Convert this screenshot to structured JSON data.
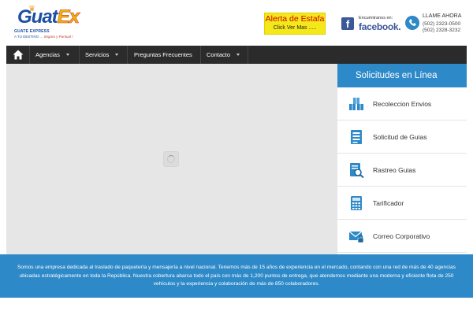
{
  "header": {
    "logo": {
      "name_main": "Guat",
      "name_accent": "Ex",
      "tagline1": "GUATE EXPRESS",
      "tagline2": "A TU DESTINO ...",
      "tagline2_accent": "Seguro y Puntual !"
    },
    "alert": {
      "title": "Alerta de Estafa",
      "subtitle": "Click Ver Mas ....."
    },
    "facebook": {
      "small": "Encuéntranos en:",
      "word": "facebook.",
      "icon": "facebook-icon"
    },
    "call": {
      "title": "LLAME AHORA",
      "phone1": "(502) 2323-0500",
      "phone2": "(502) 2328-3232",
      "icon": "phone-icon"
    }
  },
  "nav": {
    "home_icon": "home-icon",
    "items": [
      {
        "label": "Agencias",
        "has_caret": true
      },
      {
        "label": "Servicios",
        "has_caret": true
      },
      {
        "label": "Preguntas Frecuentes",
        "has_caret": false
      },
      {
        "label": "Contacto",
        "has_caret": true
      }
    ]
  },
  "sidebar": {
    "title": "Solicitudes en Línea",
    "items": [
      {
        "label": "Recoleccion Envios",
        "icon": "boxes-icon"
      },
      {
        "label": "Solicitud de Guias",
        "icon": "document-list-icon"
      },
      {
        "label": "Rastreo Guias",
        "icon": "tracking-search-icon"
      },
      {
        "label": "Tarificador",
        "icon": "calculator-icon"
      },
      {
        "label": "Correo Corporativo",
        "icon": "mail-lock-icon"
      }
    ]
  },
  "footer": {
    "text": "Somos una empresa dedicada al traslado de paquetería y mensajería a nivel nacional.    Tenemos más de 15 años de experiencia en el mercado, contando con una red de más de 40 agencias ubicadas estratégicamente en toda la República. Nuestra cobertura abarca todo el país con más de 1,200 puntos de entrega, que atendemos mediante una moderna y eficiente flota de 250 vehículos y la experiencia y colaboración de más de 850 colaboradores."
  },
  "colors": {
    "brand_blue": "#2d89c8",
    "nav_dark": "#2b2b2b",
    "alert_yellow": "#f5e81a",
    "alert_red": "#d00000"
  }
}
